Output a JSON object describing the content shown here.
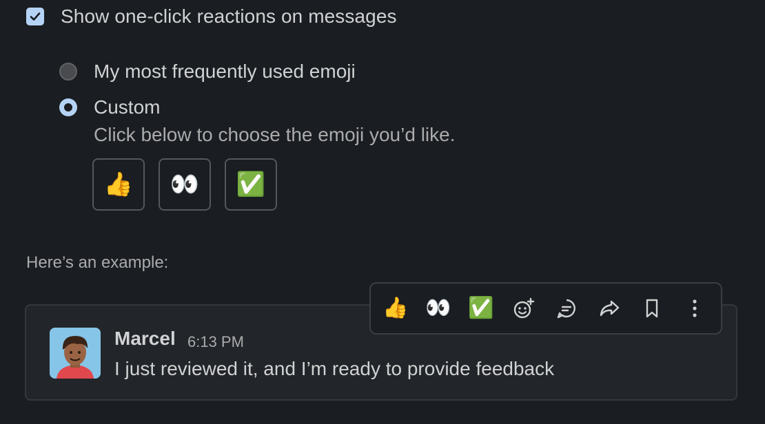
{
  "settings": {
    "show_reactions_label": "Show one-click reactions on messages",
    "show_reactions_checked": true,
    "options": [
      {
        "label": "My most frequently used emoji",
        "selected": false
      },
      {
        "label": "Custom",
        "selected": true
      }
    ],
    "custom_hint": "Click below to choose the emoji you’d like.",
    "custom_emoji": [
      {
        "name": "thumbs-up",
        "glyph": "👍"
      },
      {
        "name": "eyes",
        "glyph": "👀"
      },
      {
        "name": "white-check-mark",
        "glyph": "✅"
      }
    ]
  },
  "example": {
    "label": "Here’s an example:",
    "message": {
      "sender": "Marcel",
      "time": "6:13 PM",
      "text": "I just reviewed it, and I’m ready to provide feedback"
    },
    "toolbar": {
      "reactions": [
        "👍",
        "👀",
        "✅"
      ],
      "icons": [
        "add-reaction-icon",
        "reply-thread-icon",
        "forward-icon",
        "bookmark-icon",
        "more-actions-icon"
      ]
    }
  },
  "colors": {
    "background": "#1a1d21",
    "accent": "#b5d3f5",
    "card_background": "#222529"
  }
}
